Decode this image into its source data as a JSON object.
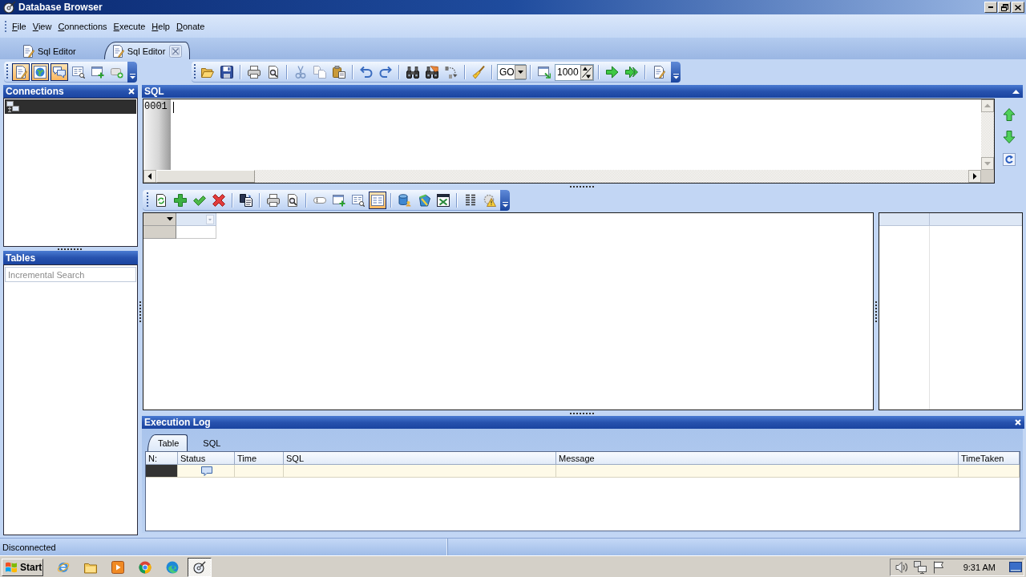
{
  "window": {
    "title": "Database Browser"
  },
  "menu": [
    "File",
    "View",
    "Connections",
    "Execute",
    "Help",
    "Donate"
  ],
  "document_tabs": [
    {
      "label": "Sql Editor",
      "selected": false
    },
    {
      "label": "Sql Editor",
      "selected": true
    }
  ],
  "main_toolbar": {
    "panel_buttons": [
      {
        "pressed": true
      },
      {
        "pressed": true
      },
      {
        "pressed": true
      },
      {
        "pressed": false
      },
      {
        "pressed": false
      },
      {
        "pressed": false
      }
    ],
    "go_dropdown": {
      "value": "GO"
    },
    "row_limit": {
      "value": "1000"
    }
  },
  "connections": {
    "title": "Connections",
    "items": [
      {
        "selected": true
      }
    ]
  },
  "tables": {
    "title": "Tables",
    "search": {
      "placeholder": "Incremental Search"
    }
  },
  "sql": {
    "title": "SQL",
    "line_numbers": [
      "0001"
    ],
    "caret": true
  },
  "results_toolbar": {
    "buttons": [
      {
        "pressed": false
      },
      {
        "pressed": false
      },
      {
        "pressed": false
      },
      {
        "pressed": false
      },
      {
        "pressed": false
      },
      {
        "pressed": false
      },
      {
        "pressed": false
      },
      {
        "pressed": false
      },
      {
        "pressed": false
      },
      {
        "pressed": false
      },
      {
        "pressed": true
      },
      {
        "pressed": false
      },
      {
        "pressed": false
      },
      {
        "pressed": false
      },
      {
        "pressed": false
      },
      {
        "pressed": false
      }
    ]
  },
  "execution_log": {
    "title": "Execution Log",
    "tabs": [
      {
        "label": "Table",
        "selected": true
      },
      {
        "label": "SQL",
        "selected": false
      }
    ],
    "columns": [
      "N:",
      "Status",
      "Time",
      "SQL",
      "Message",
      "TimeTaken"
    ],
    "rows": [
      {
        "selected": true
      }
    ]
  },
  "status_bar": {
    "text": "Disconnected"
  },
  "taskbar": {
    "start": "Start",
    "apps": [
      {
        "selected": false
      },
      {
        "selected": false
      },
      {
        "selected": false
      },
      {
        "selected": false
      },
      {
        "selected": false
      },
      {
        "selected": true
      }
    ],
    "clock": "9:31 AM"
  }
}
